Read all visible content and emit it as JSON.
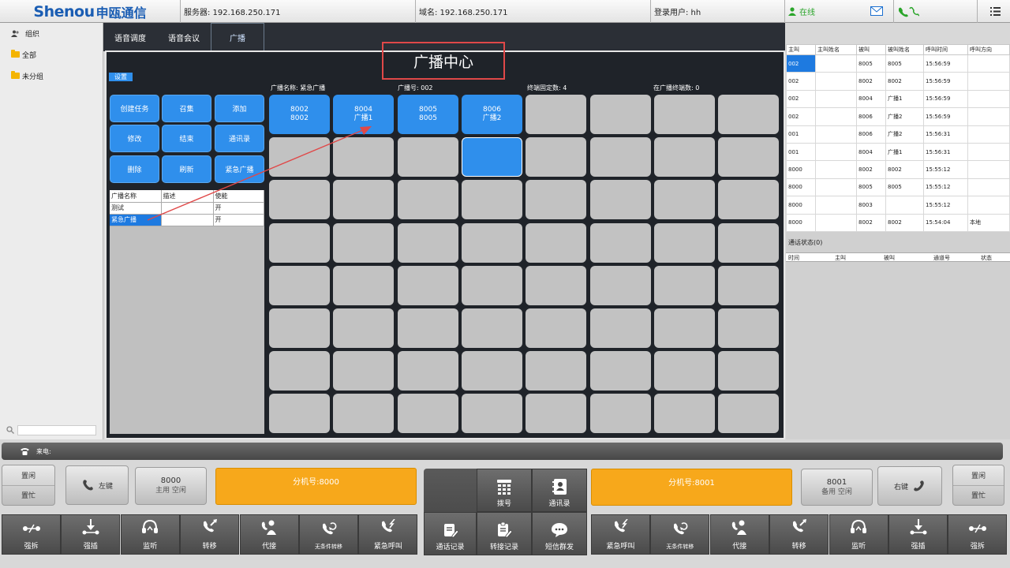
{
  "header": {
    "logo_en": "Shenou",
    "logo_cn": "申瓯通信",
    "server": "服务器: 192.168.250.171",
    "domain": "域名: 192.168.250.171",
    "user": "登录用户: hh",
    "status": "在线"
  },
  "left": {
    "root": "组织",
    "items": [
      "全部",
      "未分组"
    ]
  },
  "tabs": [
    "语音调度",
    "语音会议",
    "广播"
  ],
  "main": {
    "title": "广播中心",
    "settings": "设置",
    "buttons": [
      "创建任务",
      "召集",
      "添加",
      "修改",
      "结束",
      "通讯录",
      "删除",
      "刷新",
      "紧急广播"
    ],
    "info": {
      "name": "广播名称: 紧急广播",
      "number": "广播号: 002",
      "fixed": "终端固定数: 4",
      "online": "在广播终端数: 0"
    },
    "terminals": [
      {
        "l1": "8002",
        "l2": "8002"
      },
      {
        "l1": "8004",
        "l2": "广播1"
      },
      {
        "l1": "8005",
        "l2": "8005"
      },
      {
        "l1": "8006",
        "l2": "广播2"
      }
    ],
    "bcast_table": {
      "headers": [
        "广播名称",
        "描述",
        "使能"
      ],
      "rows": [
        [
          "测试",
          "",
          "开"
        ],
        [
          "紧急广播",
          "",
          "开"
        ]
      ]
    }
  },
  "calls": {
    "headers": [
      "主叫",
      "主叫姓名",
      "被叫",
      "被叫姓名",
      "呼叫时间",
      "呼叫方向"
    ],
    "rows": [
      [
        "002",
        "",
        "8005",
        "8005",
        "15:56:59",
        ""
      ],
      [
        "002",
        "",
        "8002",
        "8002",
        "15:56:59",
        ""
      ],
      [
        "002",
        "",
        "8004",
        "广播1",
        "15:56:59",
        ""
      ],
      [
        "002",
        "",
        "8006",
        "广播2",
        "15:56:59",
        ""
      ],
      [
        "001",
        "",
        "8006",
        "广播2",
        "15:56:31",
        ""
      ],
      [
        "001",
        "",
        "8004",
        "广播1",
        "15:56:31",
        ""
      ],
      [
        "8000",
        "",
        "8002",
        "8002",
        "15:55:12",
        ""
      ],
      [
        "8000",
        "",
        "8005",
        "8005",
        "15:55:12",
        ""
      ],
      [
        "8000",
        "",
        "8003",
        "",
        "15:55:12",
        ""
      ],
      [
        "8000",
        "",
        "8002",
        "8002",
        "15:54:04",
        "本地"
      ]
    ],
    "status_title": "通话状态(0)",
    "status_headers": [
      "时间",
      "主叫",
      "被叫",
      "通道号",
      "状态"
    ]
  },
  "bottom": {
    "incoming": "来电:",
    "idle": "置闲",
    "busy": "置忙",
    "left_key": "左键",
    "right_key": "右键",
    "left_ext": {
      "num": "8000",
      "state": "主用 空闲"
    },
    "right_ext": {
      "num": "8001",
      "state": "备用 空闲"
    },
    "left_yellow": "分机号:8000",
    "right_yellow": "分机号:8001",
    "dial": "拨号",
    "contacts": "通讯录",
    "call_log": "通话记录",
    "transfer_log": "转接记录",
    "sms": "短信群发",
    "left_actions": [
      "强拆",
      "强插",
      "监听",
      "转移",
      "代接",
      "无条件转移",
      "紧急呼叫"
    ],
    "right_actions": [
      "紧急呼叫",
      "无条件转移",
      "代接",
      "转移",
      "监听",
      "强插",
      "强拆"
    ]
  }
}
